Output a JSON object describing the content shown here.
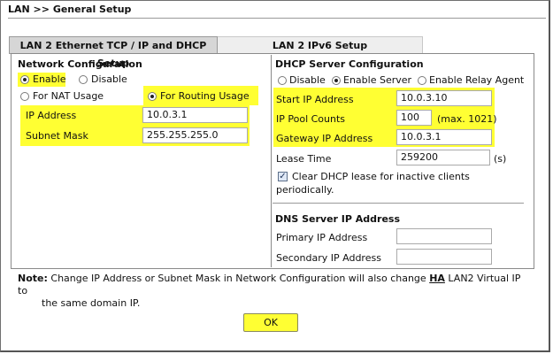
{
  "page_title": "LAN >> General Setup",
  "tabs": [
    {
      "label": "LAN 2 Ethernet TCP / IP and DHCP Setup",
      "active": true
    },
    {
      "label": "LAN 2 IPv6 Setup",
      "active": false
    }
  ],
  "network": {
    "heading": "Network Configuration",
    "enable_label": "Enable",
    "disable_label": "Disable",
    "enabled": true,
    "nat_label": "For NAT Usage",
    "routing_label": "For Routing Usage",
    "usage": "routing",
    "ip_label": "IP Address",
    "ip_value": "10.0.3.1",
    "mask_label": "Subnet Mask",
    "mask_value": "255.255.255.0"
  },
  "dhcp": {
    "heading": "DHCP Server Configuration",
    "mode_disable": "Disable",
    "mode_enable_server": "Enable Server",
    "mode_relay": "Enable Relay Agent",
    "mode": "enable_server",
    "start_ip_label": "Start IP Address",
    "start_ip_value": "10.0.3.10",
    "pool_label": "IP Pool Counts",
    "pool_value": "100",
    "pool_max": "(max. 1021)",
    "gateway_label": "Gateway IP Address",
    "gateway_value": "10.0.3.1",
    "lease_label": "Lease Time",
    "lease_value": "259200",
    "lease_unit": "(s)",
    "clear_lease_label_1": "Clear DHCP lease for inactive clients",
    "clear_lease_label_2": "periodically.",
    "clear_lease_checked": true
  },
  "dns": {
    "heading": "DNS Server IP Address",
    "primary_label": "Primary IP Address",
    "primary_value": "",
    "secondary_label": "Secondary IP Address",
    "secondary_value": ""
  },
  "note": {
    "label": "Note:",
    "text_before": "Change IP Address or Subnet Mask in Network Configuration will also change",
    "ha": "HA",
    "text_after": "LAN2 Virtual IP to",
    "line2": "the same domain IP."
  },
  "ok_label": "OK",
  "colors": {
    "highlight": "#ffff33",
    "tab_active": "#d6d6d6"
  }
}
